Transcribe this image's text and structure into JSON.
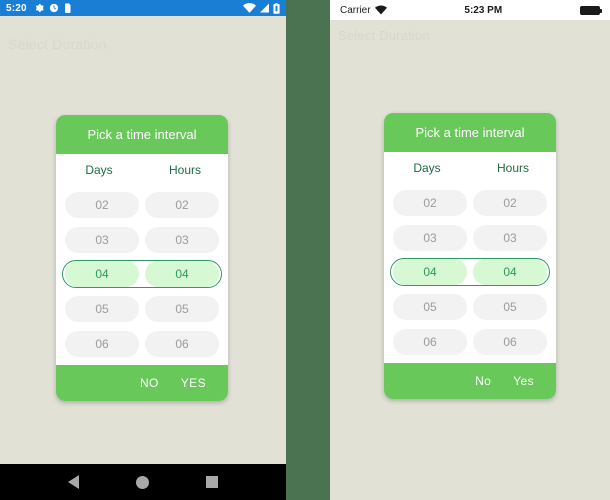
{
  "android": {
    "statusbar": {
      "time": "5:20",
      "left_icons": [
        "gear-icon",
        "alarm-icon",
        "sim-card-icon"
      ],
      "right_icons": [
        "wifi-icon",
        "signal-icon",
        "battery-icon"
      ],
      "background": "#1a7fd4"
    },
    "appbar": {
      "title": "Select Duration"
    },
    "navbar": {
      "items": [
        "back-icon",
        "home-icon",
        "recents-icon"
      ]
    },
    "dialog": {
      "header": "Pick a time interval",
      "columns": [
        "Days",
        "Hours"
      ],
      "rows": [
        {
          "days": "02",
          "hours": "02",
          "selected": false
        },
        {
          "days": "03",
          "hours": "03",
          "selected": false
        },
        {
          "days": "04",
          "hours": "04",
          "selected": true
        },
        {
          "days": "05",
          "hours": "05",
          "selected": false
        },
        {
          "days": "06",
          "hours": "06",
          "selected": false
        }
      ],
      "negative_label": "NO",
      "positive_label": "YES"
    }
  },
  "ios": {
    "statusbar": {
      "carrier": "Carrier",
      "time": "5:23 PM",
      "wifi_icon": "wifi-icon",
      "battery_icon": "battery-icon"
    },
    "appbar": {
      "title": "Select Duration"
    },
    "dialog": {
      "header": "Pick a time interval",
      "columns": [
        "Days",
        "Hours"
      ],
      "rows": [
        {
          "days": "02",
          "hours": "02",
          "selected": false
        },
        {
          "days": "03",
          "hours": "03",
          "selected": false
        },
        {
          "days": "04",
          "hours": "04",
          "selected": true
        },
        {
          "days": "05",
          "hours": "05",
          "selected": false
        },
        {
          "days": "06",
          "hours": "06",
          "selected": false
        }
      ],
      "negative_label": "No",
      "positive_label": "Yes"
    }
  },
  "theme": {
    "accent_green": "#69c85a",
    "selected_fill": "#d6f8d2",
    "selected_text": "#2d9b57",
    "selected_border": "#2e9b63",
    "column_label": "#1f6b46",
    "page_background": "#e2e1d6",
    "divider_green": "#4b7352",
    "android_status_blue": "#1a7fd4"
  }
}
